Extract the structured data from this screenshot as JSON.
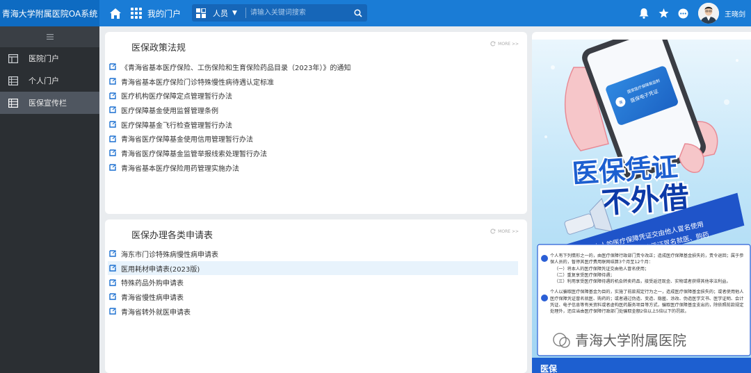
{
  "header": {
    "app_title": "青海大学附属医院OA系统",
    "portal_label": "我的门户",
    "search_category": "人员",
    "search_placeholder": "请输入关键词搜索",
    "username": "王晓剑",
    "icons": [
      "home-icon",
      "apps-grid-icon",
      "search-icon",
      "bell-icon",
      "star-icon",
      "more-chat-icon"
    ],
    "accent_color": "#1a7cd6"
  },
  "sidebar": {
    "items": [
      {
        "label": "医院门户",
        "icon": "layout-icon",
        "active": false
      },
      {
        "label": "个人门户",
        "icon": "table-icon",
        "active": false
      },
      {
        "label": "医保宣传栏",
        "icon": "table-icon",
        "active": true
      }
    ]
  },
  "policy_card": {
    "title": "医保政策法规",
    "more": "MORE >>",
    "items": [
      "《青海省基本医疗保险、工伤保险和生育保险药品目录（2023年）》的通知",
      "青海省基本医疗保险门诊特殊慢性病待遇认定标准",
      "医疗机构医疗保障定点管理暂行办法",
      "医疗保障基金使用监督管理条例",
      "医疗保障基金飞行检查管理暂行办法",
      "青海省医疗保障基金使用信用管理暂行办法",
      "青海省医疗保障基金监管举报线索处理暂行办法",
      "青海省基本医疗保险用药管理实施办法"
    ]
  },
  "forms_card": {
    "title": "医保办理各类申请表",
    "more": "MORE >>",
    "items": [
      "海东市门诊特殊病慢性病申请表",
      "医用耗材申请表(2023版)",
      "特殊药品外购申请表",
      "青海省慢性病申请表",
      "青海省转外就医申请表"
    ],
    "highlighted_index": 1
  },
  "banner": {
    "card_text_line1": "国家医疗保障局监制",
    "card_text_line2": "医保电子凭证",
    "headline1": "医保凭证",
    "headline2": "不外借",
    "ribbon_line1": "不得将本人的医疗保障凭证交由他人冒名使用",
    "ribbon_line2": "不得使用他人医疗保障凭证冒名就医、购药",
    "para1": "个人有下列情形之一的，由医疗保障行政部门责令改正；造成医疗保障基金损失的，责令退回；属于参保人员的，暂停其医疗费用联网结算3个月至12个月：",
    "list1": "（一）将本人的医疗保障凭证交由他人冒名使用；",
    "list2": "（二）重复享受医疗保障待遇；",
    "list3": "（三）利用享受医疗保障待遇的机会转卖药品，接受返还现金、实物或者获得其他非法利益。",
    "para2": "个人以骗取医疗保障基金为目的，实施了前款规定行为之一，造成医疗保障基金损失的；或者使用他人医疗保障凭证冒名就医、购药的；或者通过伪造、变造、隐匿、涂改、伪造医学文书、医学证明、会计凭证、电子信息等有关资料或者虚构医药服务项目等方式，骗取医疗保障基金支出的，除依照前款规定处理外，还应当由医疗保障行政部门处骗取金额2倍以上5倍以下的罚款。",
    "watermark": "青海大学附属医院",
    "bottom_logo": "医保"
  }
}
